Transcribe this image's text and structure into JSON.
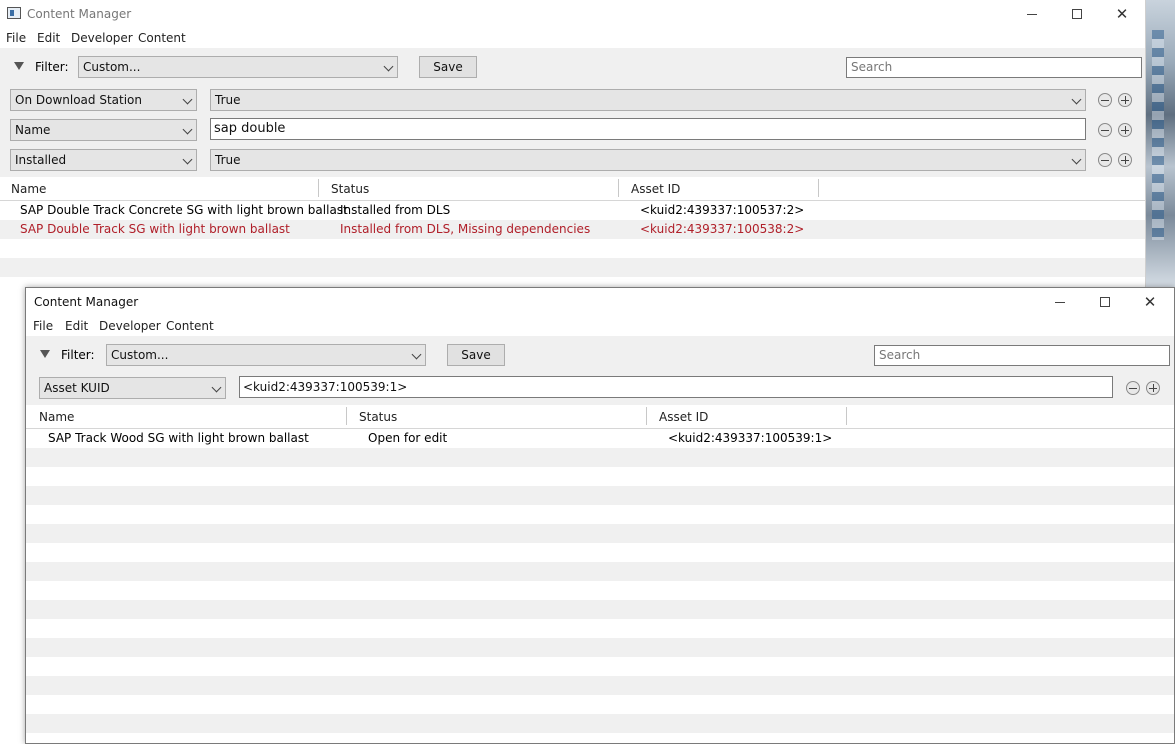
{
  "window_back": {
    "title": "Content Manager",
    "menu": [
      "File",
      "Edit",
      "Developer",
      "Content"
    ],
    "filter": {
      "label": "Filter:",
      "preset_value": "Custom...",
      "save_label": "Save",
      "search_placeholder": "Search"
    },
    "conditions": [
      {
        "field": "On Download Station",
        "value": "True",
        "type": "combo"
      },
      {
        "field": "Name",
        "value": "sap double",
        "type": "text"
      },
      {
        "field": "Installed",
        "value": "True",
        "type": "combo"
      }
    ],
    "columns": [
      "Name",
      "Status",
      "Asset ID"
    ],
    "rows": [
      {
        "name": "SAP Double Track Concrete SG with light brown ballast",
        "status": "Installed from DLS",
        "asset_id": "<kuid2:439337:100537:2>",
        "error": false
      },
      {
        "name": "SAP Double Track SG with light brown ballast",
        "status": "Installed from DLS, Missing dependencies",
        "asset_id": "<kuid2:439337:100538:2>",
        "error": true
      }
    ]
  },
  "window_front": {
    "title": "Content Manager",
    "menu": [
      "File",
      "Edit",
      "Developer",
      "Content"
    ],
    "filter": {
      "label": "Filter:",
      "preset_value": "Custom...",
      "save_label": "Save",
      "search_placeholder": "Search"
    },
    "conditions": [
      {
        "field": "Asset KUID",
        "value": "<kuid2:439337:100539:1>",
        "type": "text"
      }
    ],
    "columns": [
      "Name",
      "Status",
      "Asset ID"
    ],
    "rows": [
      {
        "name": "SAP Track Wood SG with light brown ballast",
        "status": "Open for edit",
        "asset_id": "<kuid2:439337:100539:1>",
        "error": false
      }
    ]
  },
  "colors": {
    "error_text": "#b0202a",
    "toolbar_bg": "#f0f0f0",
    "alt_row": "#f0f0f0"
  }
}
